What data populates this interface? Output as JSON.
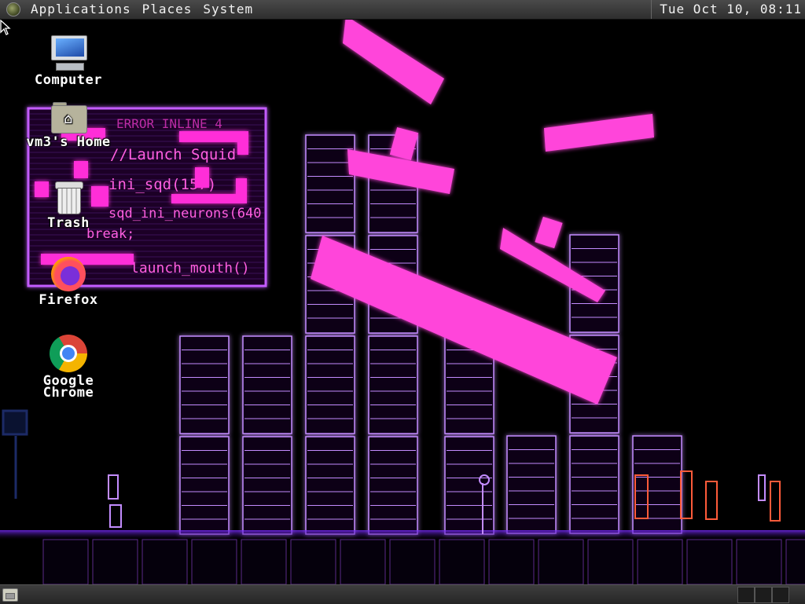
{
  "top_panel": {
    "menus": [
      "Applications",
      "Places",
      "System"
    ],
    "clock": "Tue Oct 10, 08:11"
  },
  "desktop_icons": {
    "computer": "Computer",
    "home": "vm3's Home",
    "trash": "Trash",
    "firefox": "Firefox",
    "chrome_line1": "Google",
    "chrome_line2": "Chrome"
  },
  "wallpaper": {
    "code_lines": [
      "ERROR INLINE 4",
      "//Launch Squid",
      "ini_sqd(157)",
      "sqd_ini_neurons(640",
      "break;",
      "launch_mouth()"
    ],
    "accent_color": "#ff3fd8",
    "server_color": "#c48cff"
  },
  "icons": {
    "menu_logo": "distro-logo-icon",
    "show_desktop": "show-desktop-icon",
    "pointer": "mouse-pointer-icon"
  }
}
